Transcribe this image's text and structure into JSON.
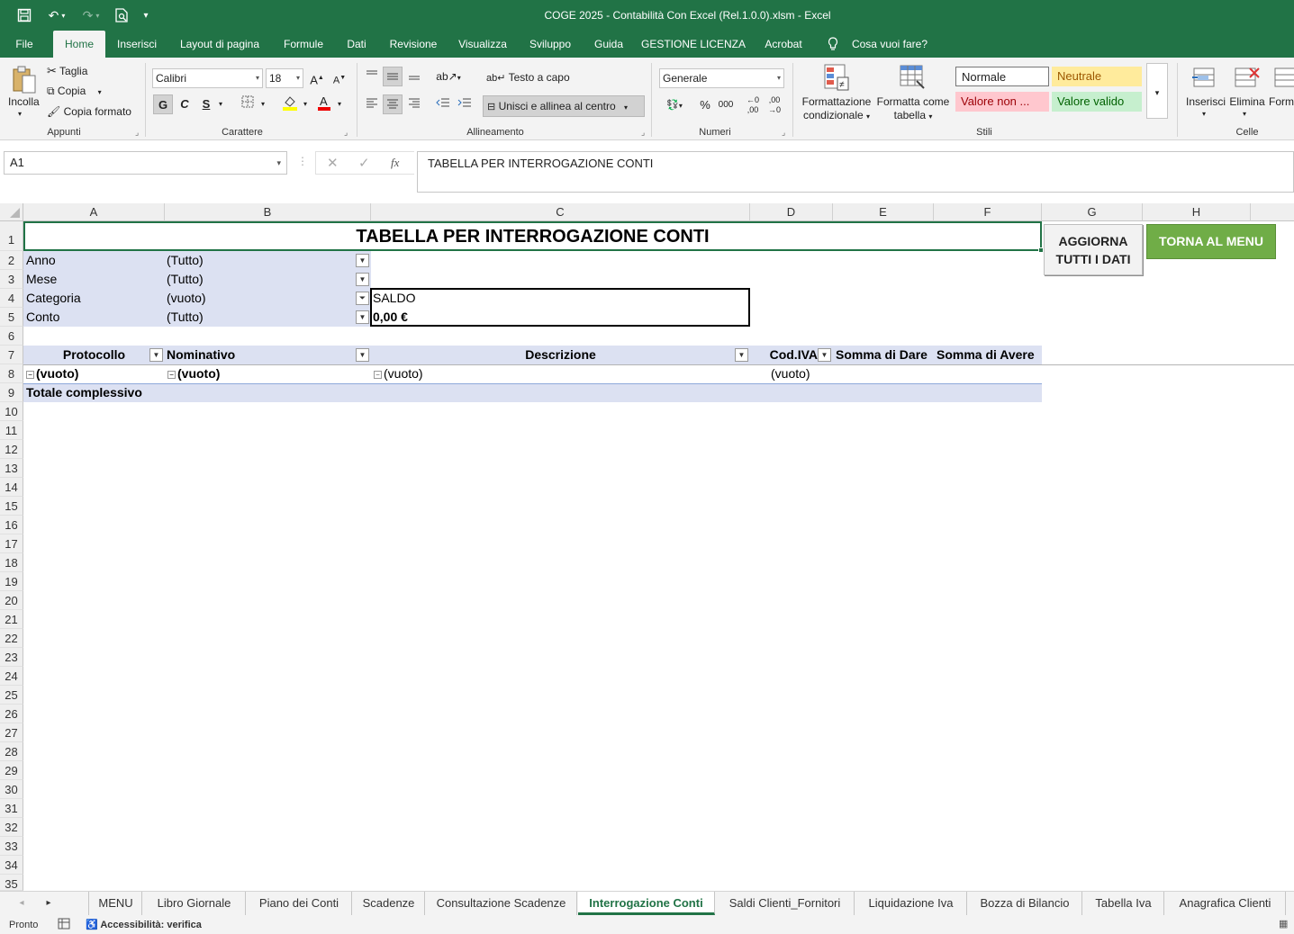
{
  "titlebar": {
    "title": "COGE 2025 - Contabilità Con Excel (Rel.1.0.0).xlsm  -  Excel"
  },
  "menu": {
    "tabs": [
      "File",
      "Home",
      "Inserisci",
      "Layout di pagina",
      "Formule",
      "Dati",
      "Revisione",
      "Visualizza",
      "Sviluppo",
      "Guida",
      "GESTIONE LICENZA",
      "Acrobat",
      "Cosa vuoi fare?"
    ]
  },
  "ribbon": {
    "appunti": {
      "paste": "Incolla",
      "cut": "Taglia",
      "copy": "Copia",
      "format_painter": "Copia formato",
      "group": "Appunti"
    },
    "carattere": {
      "font": "Calibri",
      "size": "18",
      "bold": "G",
      "italic": "C",
      "underline": "S",
      "group": "Carattere"
    },
    "allineamento": {
      "wrap": "Testo a capo",
      "merge": "Unisci e allinea al centro",
      "group": "Allineamento"
    },
    "numeri": {
      "format": "Generale",
      "group": "Numeri"
    },
    "stili": {
      "cond_format": [
        "Formattazione",
        "condizionale"
      ],
      "format_table": [
        "Formatta come",
        "tabella"
      ],
      "normal": "Normale",
      "neutral": "Neutrale",
      "bad": "Valore non ...",
      "good": "Valore valido",
      "group": "Stili"
    },
    "celle": {
      "insert": "Inserisci",
      "delete": "Elimina",
      "format": "Form",
      "group": "Celle"
    }
  },
  "formula_bar": {
    "name_box": "A1",
    "content": "TABELLA PER INTERROGAZIONE CONTI"
  },
  "grid": {
    "columns": [
      "A",
      "B",
      "C",
      "D",
      "E",
      "F",
      "G",
      "H"
    ],
    "rows": [
      "1",
      "2",
      "3",
      "4",
      "5",
      "6",
      "7",
      "8",
      "9",
      "10",
      "11",
      "12",
      "13",
      "14",
      "15",
      "16",
      "17",
      "18",
      "19",
      "20",
      "21",
      "22",
      "23",
      "24",
      "25",
      "26",
      "27",
      "28",
      "29",
      "30",
      "31",
      "32",
      "33",
      "34",
      "35"
    ],
    "title": "TABELLA PER INTERROGAZIONE CONTI",
    "filters": [
      {
        "label": "Anno",
        "value": "(Tutto)"
      },
      {
        "label": "Mese",
        "value": "(Tutto)"
      },
      {
        "label": "Categoria",
        "value": "(vuoto)"
      },
      {
        "label": "Conto",
        "value": "(Tutto)"
      }
    ],
    "saldo_label": "SALDO",
    "saldo_value": "0,00 €",
    "pivot_headers": [
      "Protocollo",
      "Nominativo",
      "Descrizione",
      "Cod.IVA",
      "Somma di Dare",
      "Somma di Avere"
    ],
    "pivot_row": [
      "(vuoto)",
      "(vuoto)",
      "(vuoto)",
      "(vuoto)"
    ],
    "total_label": "Totale complessivo",
    "button_refresh": [
      "AGGIORNA",
      "TUTTI I DATI"
    ],
    "button_menu": "TORNA AL MENU"
  },
  "sheets": [
    "MENU",
    "Libro Giornale",
    "Piano dei Conti",
    "Scadenze",
    "Consultazione Scadenze",
    "Interrogazione Conti",
    "Saldi Clienti_Fornitori",
    "Liquidazione Iva",
    "Bozza di Bilancio",
    "Tabella Iva",
    "Anagrafica Clienti"
  ],
  "active_sheet": "Interrogazione Conti",
  "status": {
    "ready": "Pronto",
    "accessibility": "Accessibilità: verifica"
  },
  "colors": {
    "excel_green": "#217346",
    "header_bg": "#dce1f2",
    "button_green": "#70ad47"
  }
}
